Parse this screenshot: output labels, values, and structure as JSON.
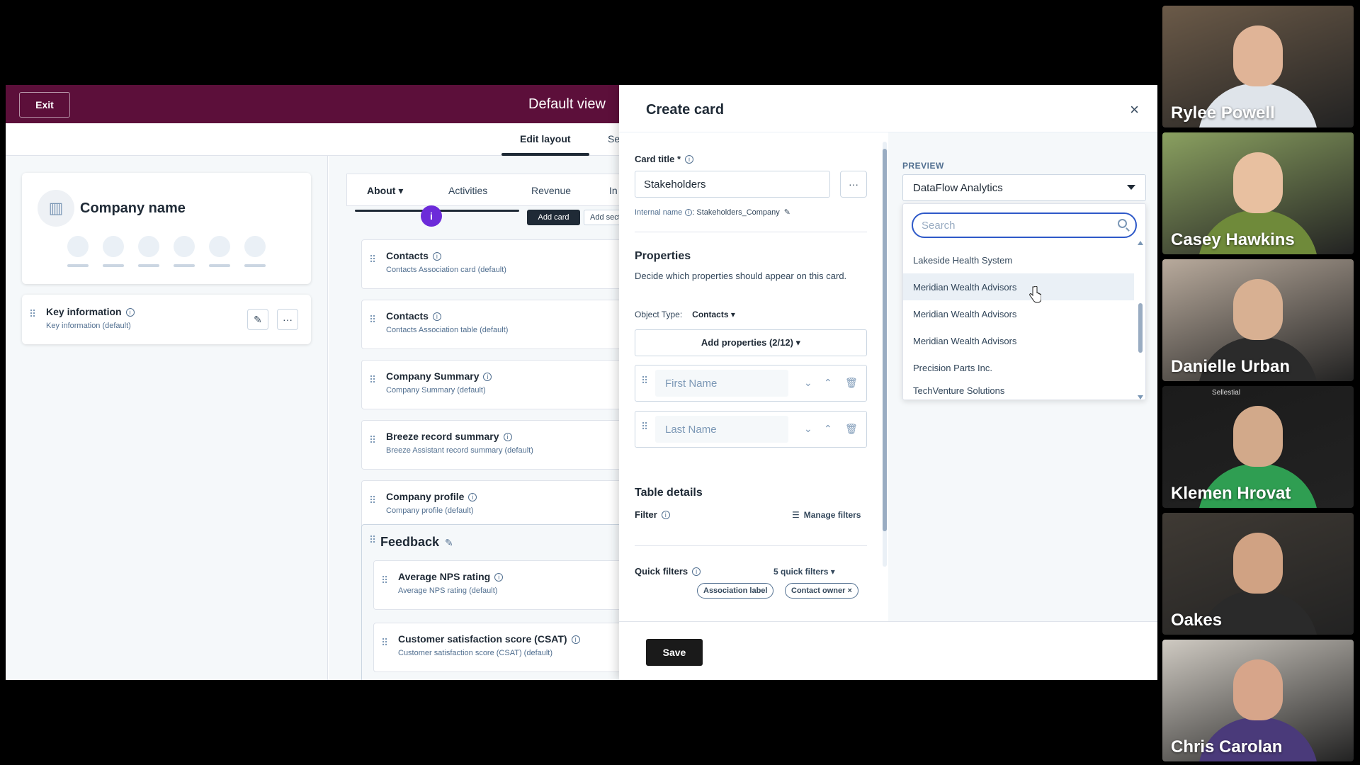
{
  "topbar": {
    "exit_label": "Exit",
    "view_title": "Default view"
  },
  "subtabs": {
    "edit_layout": "Edit layout",
    "more": "Se"
  },
  "left": {
    "company_name": "Company name",
    "key_info": {
      "title": "Key information",
      "sub": "Key information (default)"
    }
  },
  "middle": {
    "tabs": [
      "About ▾",
      "Activities",
      "Revenue",
      "In"
    ],
    "purple_dot": "i",
    "add_card": "Add card",
    "add_section": "Add secti",
    "cards": [
      {
        "title": "Contacts",
        "sub": "Contacts Association card (default)"
      },
      {
        "title": "Contacts",
        "sub": "Contacts Association table (default)"
      },
      {
        "title": "Company Summary",
        "sub": "Company Summary (default)"
      },
      {
        "title": "Breeze record summary",
        "sub": "Breeze Assistant record summary (default)"
      },
      {
        "title": "Company profile",
        "sub": "Company profile (default)"
      }
    ],
    "feedback": {
      "title": "Feedback",
      "cards": [
        {
          "title": "Average NPS rating",
          "sub": "Average NPS rating (default)"
        },
        {
          "title": "Customer satisfaction score (CSAT)",
          "sub": "Customer satisfaction score (CSAT) (default)"
        }
      ]
    }
  },
  "modal": {
    "title": "Create card",
    "close": "×",
    "card_title_label": "Card title *",
    "card_title_value": "Stakeholders",
    "internal_name_label": "Internal name",
    "internal_name_value": ": Stakeholders_Company",
    "properties_title": "Properties",
    "properties_desc": "Decide which properties should appear on this card.",
    "object_type_label": "Object Type:",
    "object_type_value": "Contacts ▾",
    "add_properties": "Add properties (2/12) ▾",
    "properties": [
      {
        "placeholder": "First Name"
      },
      {
        "placeholder": "Last Name"
      }
    ],
    "table_details_title": "Table details",
    "filter_label": "Filter",
    "manage_filters": "Manage filters",
    "quick_filters_label": "Quick filters",
    "quick_filters_count": "5 quick filters ▾",
    "quick_filter_pills": [
      "Association label",
      "Contact owner ×"
    ],
    "save_label": "Save"
  },
  "preview": {
    "label": "PREVIEW",
    "selected": "DataFlow Analytics",
    "search_placeholder": "Search",
    "options": [
      "Lakeside Health System",
      "Meridian Wealth Advisors",
      "Meridian Wealth Advisors",
      "Meridian Wealth Advisors",
      "Precision Parts Inc.",
      "TechVenture Solutions"
    ]
  },
  "participants": [
    {
      "name": "Rylee Powell",
      "bg": "#6b5a48",
      "skin": "#e0b497",
      "shirt": "#dfe4ea"
    },
    {
      "name": "Casey Hawkins",
      "bg": "#8aa060",
      "skin": "#e8c0a0",
      "shirt": "#6f8a3a"
    },
    {
      "name": "Danielle Urban",
      "bg": "#b8aa9c",
      "skin": "#d8b092",
      "shirt": "#2b2b2b"
    },
    {
      "name": "Klemen Hrovat",
      "bg": "#1b1b1b",
      "skin": "#d2a98a",
      "shirt": "#2f9e52",
      "tag": "Sellestial"
    },
    {
      "name": "Oakes",
      "bg": "#3f3a34",
      "skin": "#d0a283",
      "shirt": "#2a2a2a"
    },
    {
      "name": "Chris Carolan",
      "bg": "#cfcac2",
      "skin": "#d7a58a",
      "shirt": "#4a3a7a"
    }
  ]
}
